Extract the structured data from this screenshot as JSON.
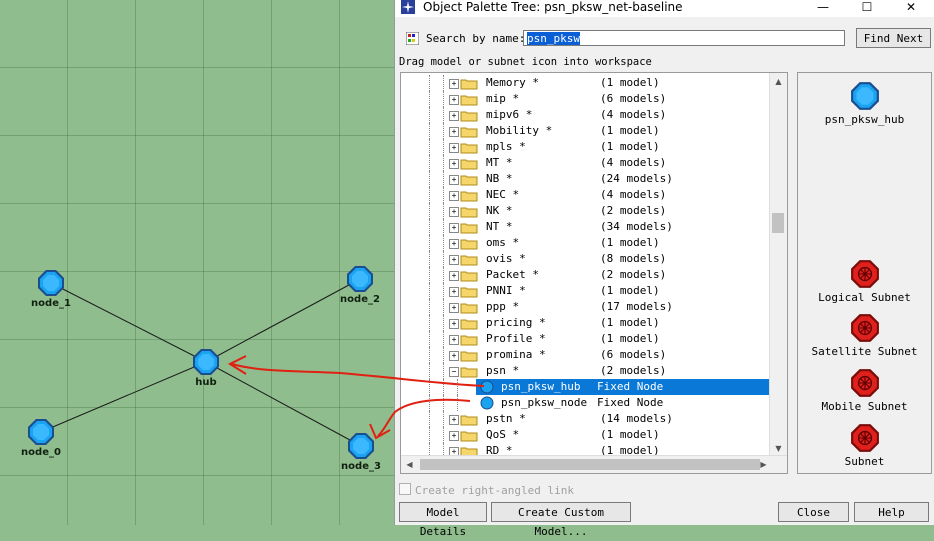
{
  "workspace": {
    "nodes": [
      {
        "label": "node_1"
      },
      {
        "label": "node_2"
      },
      {
        "label": "hub"
      },
      {
        "label": "node_0"
      },
      {
        "label": "node_3"
      }
    ]
  },
  "dialog": {
    "title": "Object Palette Tree: psn_pksw_net-baseline",
    "window_controls": {
      "minimize": "—",
      "maximize": "☐",
      "close": "✕"
    },
    "search_label": "Search by name:",
    "search_value": "psn_pksw",
    "find_next_label": "Find Next",
    "instruction": "Drag model or subnet icon into workspace",
    "tree_rows": [
      {
        "name": "Memory *",
        "count": "(1 model)"
      },
      {
        "name": "mip *",
        "count": "(6 models)"
      },
      {
        "name": "mipv6 *",
        "count": "(4 models)"
      },
      {
        "name": "Mobility *",
        "count": "(1 model)"
      },
      {
        "name": "mpls *",
        "count": "(1 model)"
      },
      {
        "name": "MT *",
        "count": "(4 models)"
      },
      {
        "name": "NB *",
        "count": "(24 models)"
      },
      {
        "name": "NEC *",
        "count": "(4 models)"
      },
      {
        "name": "NK *",
        "count": "(2 models)"
      },
      {
        "name": "NT *",
        "count": "(34 models)"
      },
      {
        "name": "oms *",
        "count": "(1 model)"
      },
      {
        "name": "ovis *",
        "count": "(8 models)"
      },
      {
        "name": "Packet *",
        "count": "(2 models)"
      },
      {
        "name": "PNNI *",
        "count": "(1 model)"
      },
      {
        "name": "ppp *",
        "count": "(17 models)"
      },
      {
        "name": "pricing *",
        "count": "(1 model)"
      },
      {
        "name": "Profile *",
        "count": "(1 model)"
      },
      {
        "name": "promina *",
        "count": "(6 models)"
      },
      {
        "name": "psn *",
        "count": "(2 models)"
      },
      {
        "child": true,
        "selected": true,
        "name": "psn_pksw_hub",
        "type": "Fixed Node"
      },
      {
        "child": true,
        "selected": false,
        "name": "psn_pksw_node",
        "type": "Fixed Node"
      },
      {
        "name": "pstn *",
        "count": "(14 models)"
      },
      {
        "name": "QoS *",
        "count": "(1 model)"
      },
      {
        "name": "RD *",
        "count": "(1 model)"
      }
    ],
    "preview": {
      "selected_model": "psn_pksw_hub",
      "subnets": [
        "Logical Subnet",
        "Satellite Subnet",
        "Mobile Subnet",
        "Subnet"
      ]
    },
    "right_angle_label": "Create right-angled link",
    "buttons": {
      "model_details": "Model Details",
      "create_custom": "Create Custom Model...",
      "close": "Close",
      "help": "Help"
    }
  },
  "colors": {
    "workspace_bg": "#90bd8e",
    "node_fill": "#1aa3f0",
    "subnet_fill": "#e0201c",
    "selection": "#0a78d7",
    "annotation": "#e02010"
  }
}
